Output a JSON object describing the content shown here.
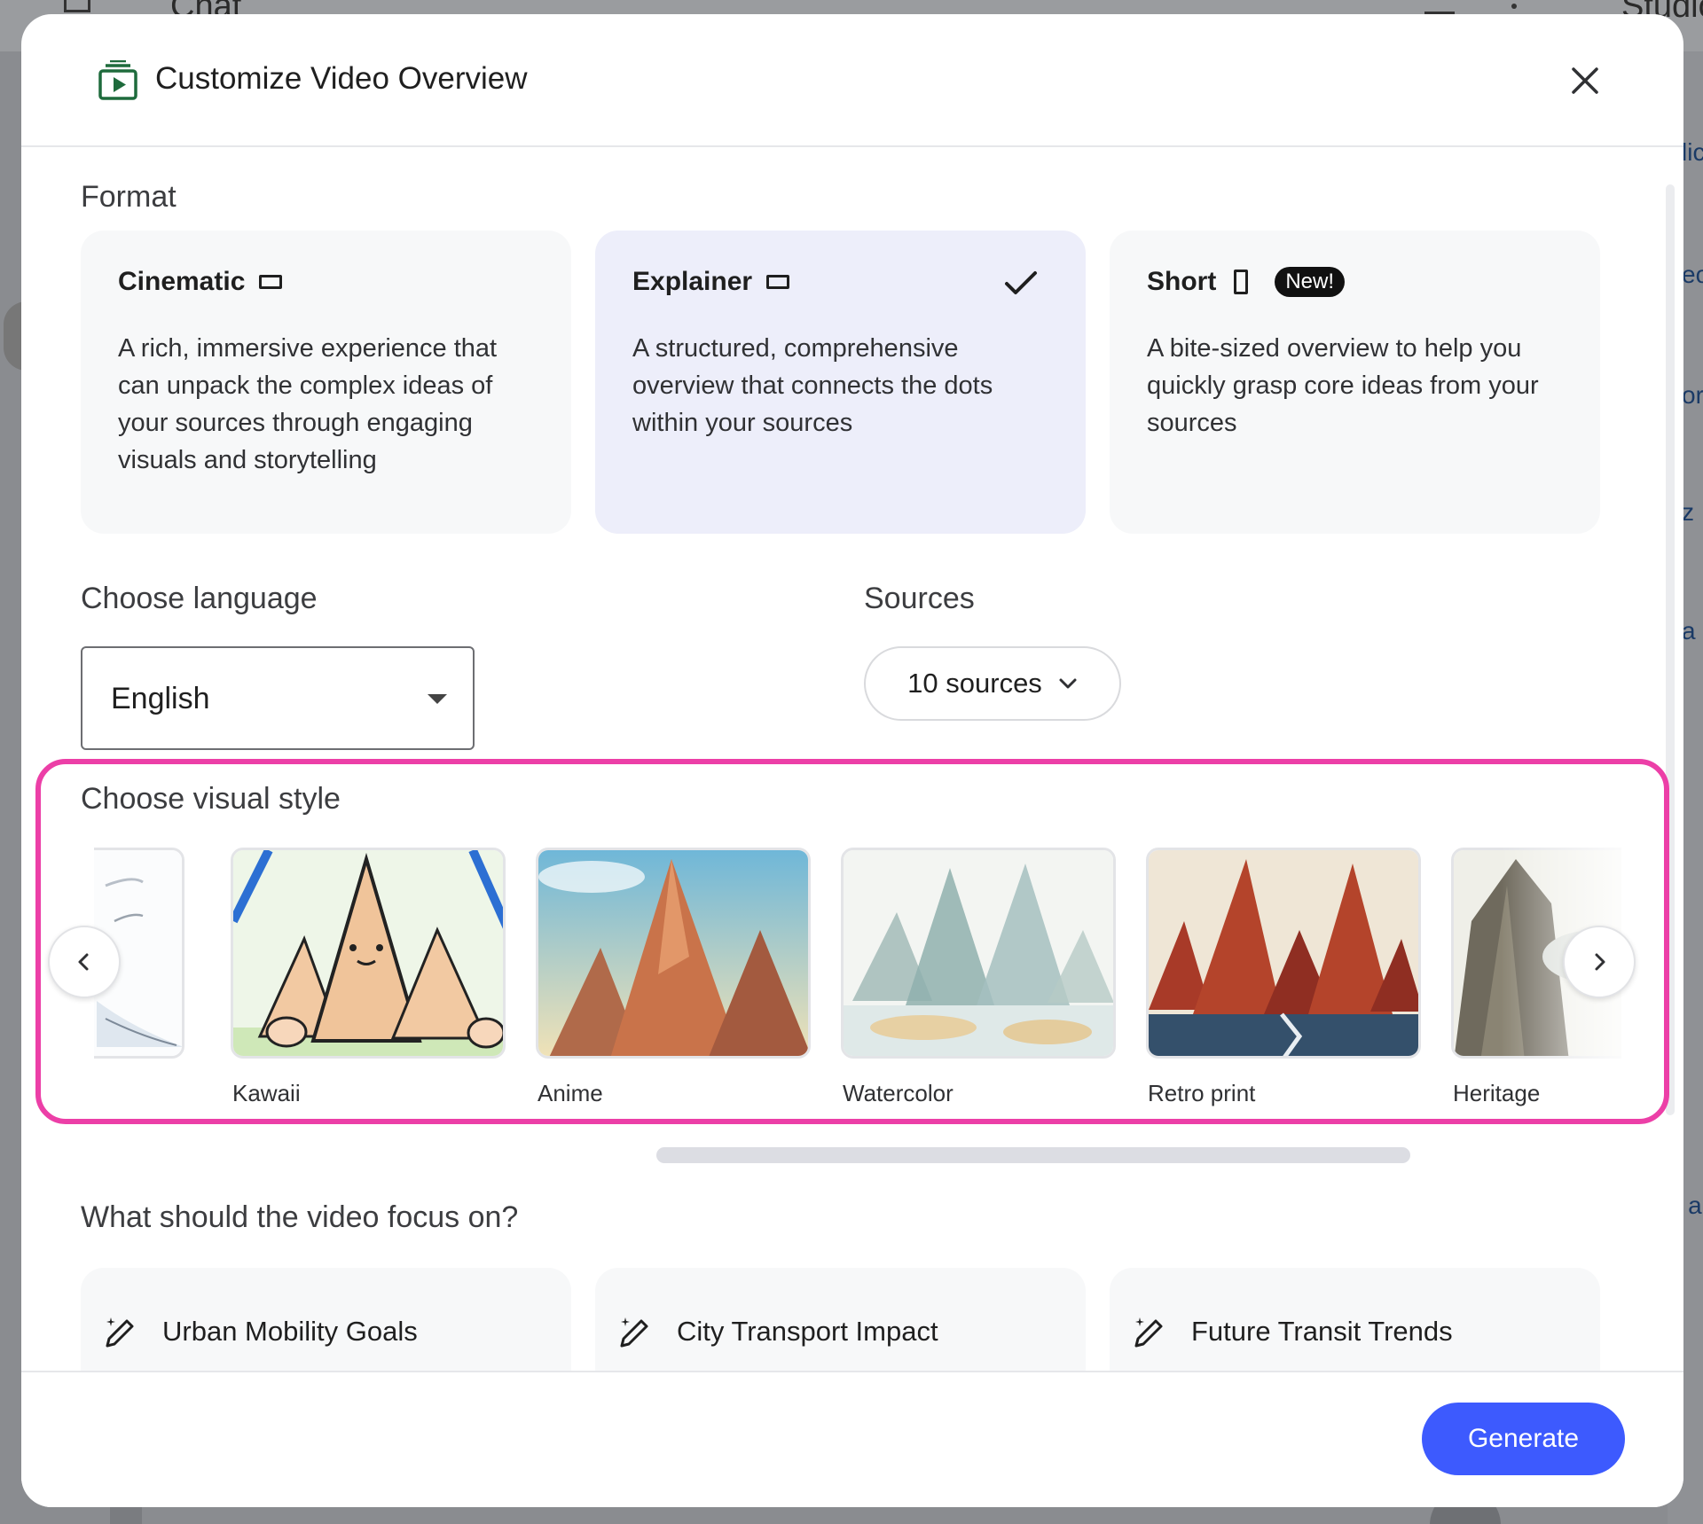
{
  "background": {
    "chat_label": "Chat",
    "studio_label": "Studio",
    "right_fragments": [
      "lic",
      "eo",
      "or",
      "z",
      "a",
      "r a"
    ]
  },
  "dialog": {
    "title": "Customize Video Overview",
    "header_icon": "video-overview-icon",
    "close_icon": "close-icon"
  },
  "format": {
    "label": "Format",
    "options": [
      {
        "name": "Cinematic",
        "aspect_icon": "landscape-icon",
        "description": "A rich, immersive experience that can unpack the complex ideas of your sources through engaging visuals and storytelling",
        "selected": false
      },
      {
        "name": "Explainer",
        "aspect_icon": "landscape-icon",
        "description": "A structured, comprehensive overview that connects the dots within your sources",
        "selected": true
      },
      {
        "name": "Short",
        "aspect_icon": "portrait-icon",
        "badge": "New!",
        "description": "A bite-sized overview to help you quickly grasp core ideas from your sources",
        "selected": false
      }
    ]
  },
  "language": {
    "label": "Choose language",
    "value": "English"
  },
  "sources": {
    "label": "Sources",
    "value": "10 sources"
  },
  "visual_style": {
    "label": "Choose visual style",
    "styles": [
      {
        "name": "Kawaii"
      },
      {
        "name": "Anime"
      },
      {
        "name": "Watercolor"
      },
      {
        "name": "Retro print"
      },
      {
        "name": "Heritage"
      }
    ]
  },
  "focus": {
    "label": "What should the video focus on?",
    "suggestions": [
      "Urban Mobility Goals",
      "City Transport Impact",
      "Future Transit Trends"
    ]
  },
  "footer": {
    "generate_label": "Generate"
  },
  "colors": {
    "accent": "#3d5afe",
    "highlight": "#ec3fa7",
    "selected_card": "#edeefa",
    "brand_icon": "#1e6b3c"
  }
}
